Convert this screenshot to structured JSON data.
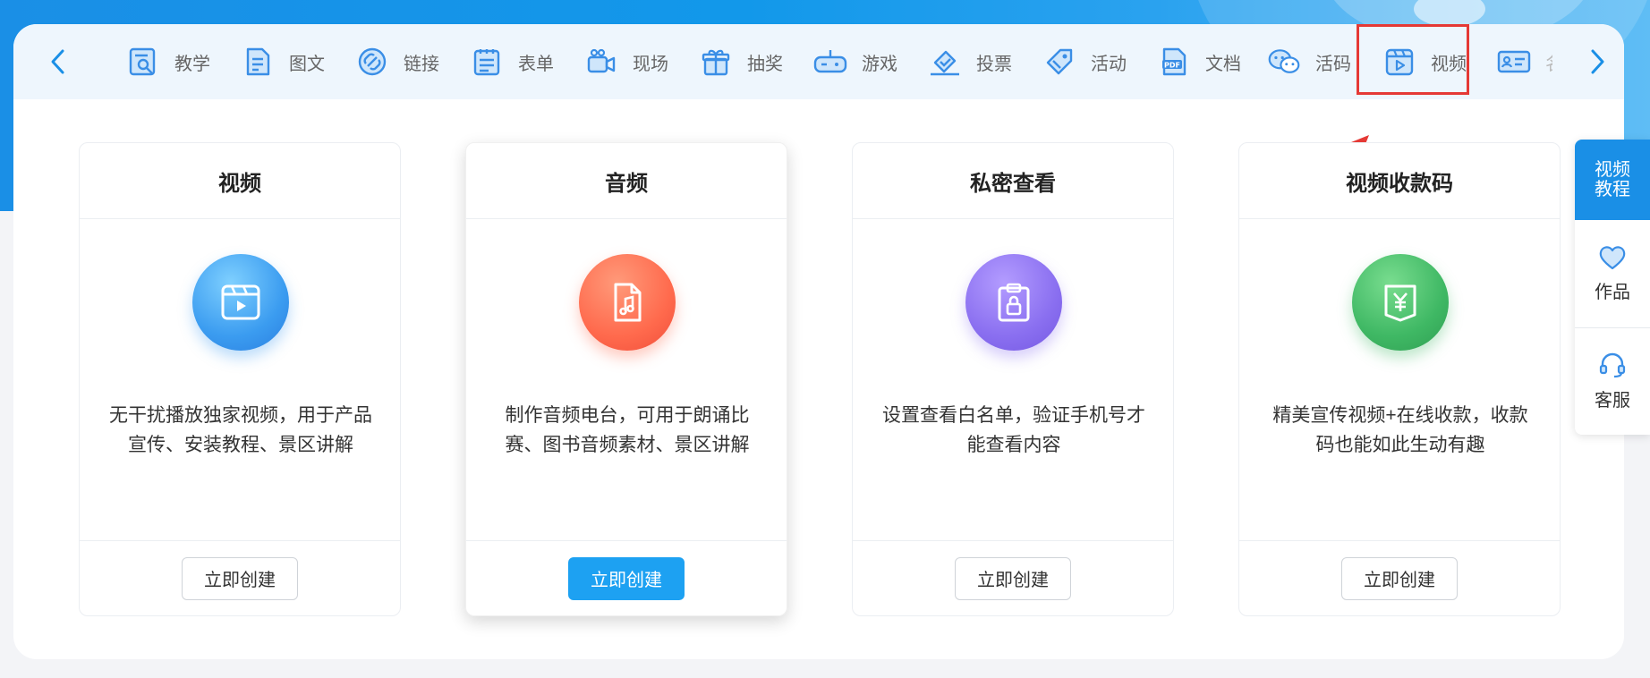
{
  "colors": {
    "accent": "#1da1f2",
    "banner": "#1a8fe6",
    "highlight": "#e53935",
    "tab_icon": "#3a8ee6"
  },
  "tabbar": {
    "prev_icon": "chevron-left-icon",
    "next_icon": "chevron-right-icon",
    "tabs": [
      {
        "label": "教学",
        "icon": "teaching-icon"
      },
      {
        "label": "图文",
        "icon": "document-text-icon"
      },
      {
        "label": "链接",
        "icon": "link-icon"
      },
      {
        "label": "表单",
        "icon": "form-icon"
      },
      {
        "label": "现场",
        "icon": "camera-icon"
      },
      {
        "label": "抽奖",
        "icon": "gift-icon"
      },
      {
        "label": "游戏",
        "icon": "gamepad-icon"
      },
      {
        "label": "投票",
        "icon": "vote-icon"
      },
      {
        "label": "活动",
        "icon": "tag-icon"
      },
      {
        "label": "文档",
        "icon": "pdf-icon"
      },
      {
        "label": "活码",
        "icon": "wechat-icon"
      },
      {
        "label": "视频",
        "icon": "video-icon",
        "highlighted": true
      },
      {
        "label": "名",
        "icon": "id-card-icon"
      }
    ]
  },
  "cards": [
    {
      "title": "视频",
      "desc": "无干扰播放独家视频，用于产品宣传、安装教程、景区讲解",
      "button": "立即创建",
      "icon": "video-play-icon",
      "active": false
    },
    {
      "title": "音频",
      "desc": "制作音频电台，可用于朗诵比赛、图书音频素材、景区讲解",
      "button": "立即创建",
      "icon": "music-file-icon",
      "active": true
    },
    {
      "title": "私密查看",
      "desc": "设置查看白名单，验证手机号才能查看内容",
      "button": "立即创建",
      "icon": "lock-clipboard-icon",
      "active": false
    },
    {
      "title": "视频收款码",
      "desc": "精美宣传视频+在线收款，收款码也能如此生动有趣",
      "button": "立即创建",
      "icon": "yuan-icon",
      "active": false
    }
  ],
  "side": {
    "tutorial": "视频教程",
    "items": [
      {
        "label": "作品",
        "icon": "heart-icon"
      },
      {
        "label": "客服",
        "icon": "headset-icon"
      }
    ]
  }
}
